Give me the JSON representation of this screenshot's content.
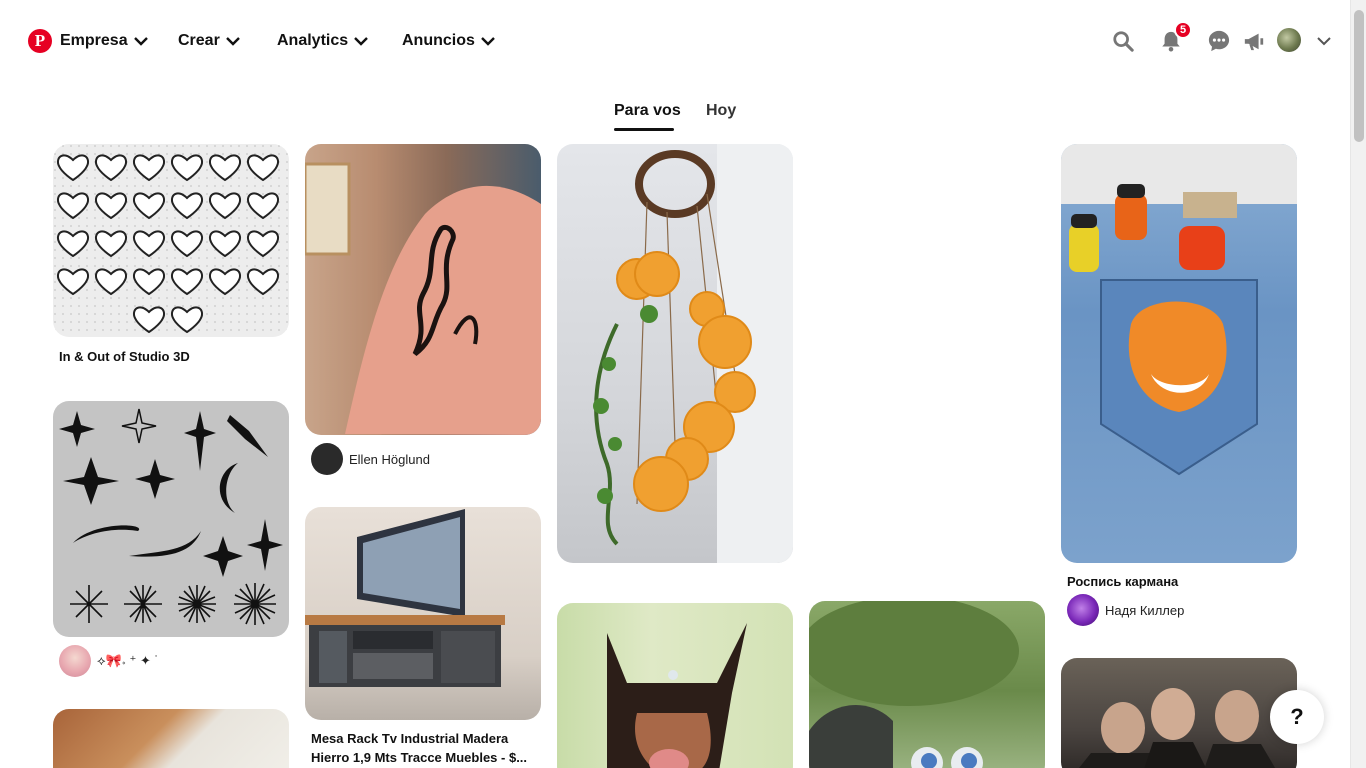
{
  "header": {
    "logo_letter": "P",
    "nav": [
      {
        "label": "Empresa"
      },
      {
        "label": "Crear"
      },
      {
        "label": "Analytics"
      },
      {
        "label": "Anuncios"
      }
    ],
    "notifications_count": "5"
  },
  "tabs": [
    {
      "label": "Para vos",
      "active": true
    },
    {
      "label": "Hoy",
      "active": false
    }
  ],
  "pins": [
    {
      "title": "In & Out of Studio 3D",
      "image": "heart-letters-image"
    },
    {
      "user": "Ellen Höglund",
      "image": "tattoo-arm-image"
    },
    {
      "title": "",
      "user": "⟡🎀𝆹 ⁺ ✦ ˙",
      "image": "sparkle-shapes-image"
    },
    {
      "title": "Mesa Rack Tv Industrial Madera Hierro 1,9 Mts Tracce Muebles - $...",
      "image": "tv-stand-image"
    },
    {
      "image": "dried-orange-chime-image"
    },
    {
      "image": "doberman-image"
    },
    {
      "image": "park-eyeballs-image"
    },
    {
      "title": "Роспись кармана",
      "user": "Надя Киллер",
      "image": "painted-jeans-image"
    },
    {
      "image": "peaky-blinders-image"
    }
  ],
  "help_label": "?",
  "colors": {
    "brand": "#e60023",
    "text": "#111111",
    "muted": "#767676"
  }
}
